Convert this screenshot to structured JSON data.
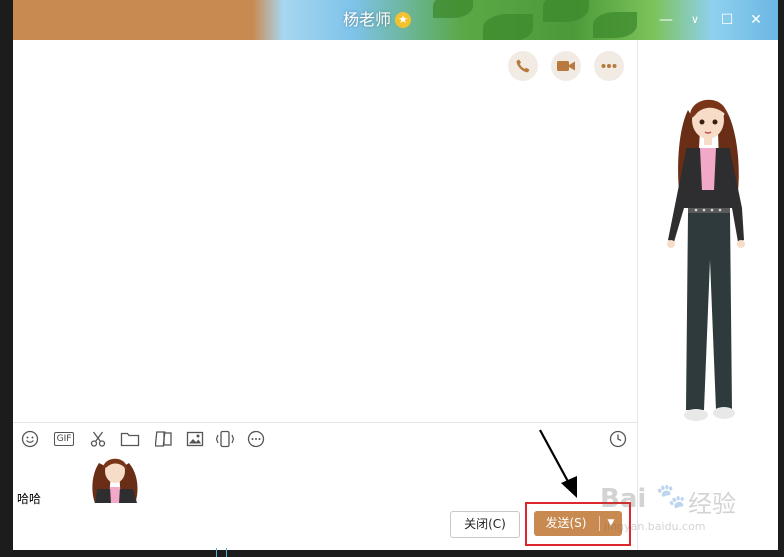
{
  "window": {
    "title": "杨老师",
    "title_badge_icon": "star-icon"
  },
  "window_controls": [
    {
      "name": "minimize-icon",
      "glyph": "—"
    },
    {
      "name": "maximize-icon",
      "glyph": "□"
    },
    {
      "name": "close-icon",
      "glyph": "✕"
    }
  ],
  "header_actions": [
    {
      "name": "phone-call-button",
      "icon": "phone-icon"
    },
    {
      "name": "video-call-button",
      "icon": "video-camera-icon"
    },
    {
      "name": "more-options-button",
      "icon": "more-dots-icon"
    }
  ],
  "toolbar": [
    {
      "name": "emoji-icon"
    },
    {
      "name": "gif-icon",
      "label": "GIF"
    },
    {
      "name": "screenshot-scissors-icon"
    },
    {
      "name": "folder-icon"
    },
    {
      "name": "sticker-icon"
    },
    {
      "name": "image-icon"
    },
    {
      "name": "shake-window-icon"
    },
    {
      "name": "more-icon"
    }
  ],
  "history_icon": "clock-icon",
  "composer": {
    "text": "哈哈",
    "attached_image": "girl-avatar-image"
  },
  "buttons": {
    "close_label": "关闭(C)",
    "send_label": "发送(S)"
  },
  "watermark": {
    "brand": "Bai",
    "brand_cn": "经验",
    "url": "jingyan.baidu.com"
  },
  "colors": {
    "accent": "#c98a52",
    "highlight": "#e0262a"
  }
}
